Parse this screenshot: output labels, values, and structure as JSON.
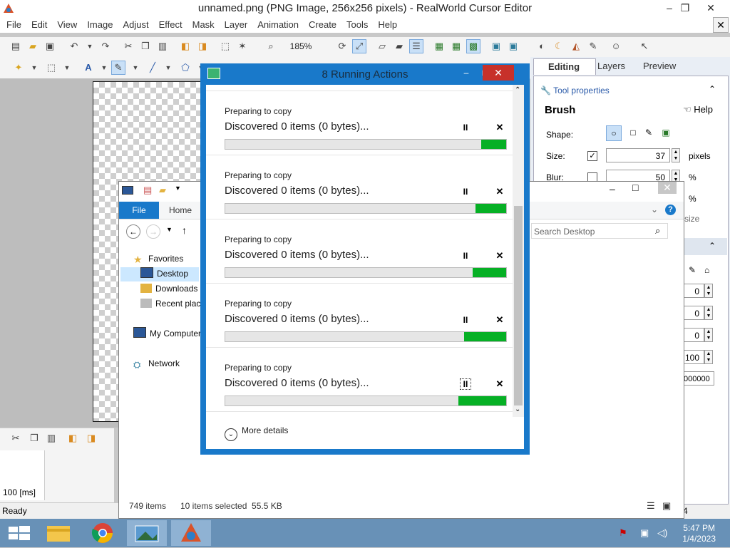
{
  "app": {
    "title": "unnamed.png (PNG Image, 256x256 pixels) - RealWorld Cursor Editor",
    "window_controls": {
      "minimize": "–",
      "maximize": "❐",
      "close": "✕",
      "mdi_close": "✕"
    },
    "menus": [
      "File",
      "Edit",
      "View",
      "Image",
      "Adjust",
      "Effect",
      "Mask",
      "Layer",
      "Animation",
      "Create",
      "Tools",
      "Help"
    ],
    "zoom": "185%",
    "status": "Ready",
    "frame_duration": "100 [ms]"
  },
  "right_panel": {
    "tabs": [
      "Editing",
      "Layers",
      "Preview"
    ],
    "section_title": "Tool properties",
    "tool_name": "Brush",
    "help": "Help",
    "shape_label": "Shape:",
    "size_label": "Size:",
    "size_value": "37",
    "size_unit": "pixels",
    "blur_label": "Blur:",
    "blur_value": "50",
    "blur_unit": "%",
    "extra_unit": "%",
    "extra_text": "size",
    "num_fields": [
      "0",
      "0",
      "0",
      "100"
    ],
    "color_field": "000000",
    "side_number": "4"
  },
  "explorer": {
    "tabs": {
      "file": "File",
      "home": "Home"
    },
    "search_placeholder": "Search Desktop",
    "nav": [
      "Favorites",
      "Desktop",
      "Downloads",
      "Recent places",
      "My Computer",
      "Network"
    ],
    "status_items": "749 items",
    "status_selected": "10 items selected  55.5 KB"
  },
  "dialog": {
    "title": "8 Running Actions",
    "items": [
      {
        "small": "Preparing to copy",
        "large": "Discovered 0 items (0 bytes)...",
        "progress": 0.09
      },
      {
        "small": "Preparing to copy",
        "large": "Discovered 0 items (0 bytes)...",
        "progress": 0.11
      },
      {
        "small": "Preparing to copy",
        "large": "Discovered 0 items (0 bytes)...",
        "progress": 0.12
      },
      {
        "small": "Preparing to copy",
        "large": "Discovered 0 items (0 bytes)...",
        "progress": 0.15
      },
      {
        "small": "Preparing to copy",
        "large": "Discovered 0 items (0 bytes)...",
        "progress": 0.17
      }
    ],
    "pause_icon": "II",
    "cancel_icon": "✕",
    "more_details": "More details",
    "accent_color": "#1979ca",
    "progress_color": "#06b025"
  },
  "taskbar": {
    "time": "5:47 PM",
    "date": "1/4/2023",
    "apps": [
      "start-icon",
      "file-explorer-icon",
      "chrome-icon",
      "photo-viewer-icon",
      "cursor-editor-icon"
    ]
  }
}
